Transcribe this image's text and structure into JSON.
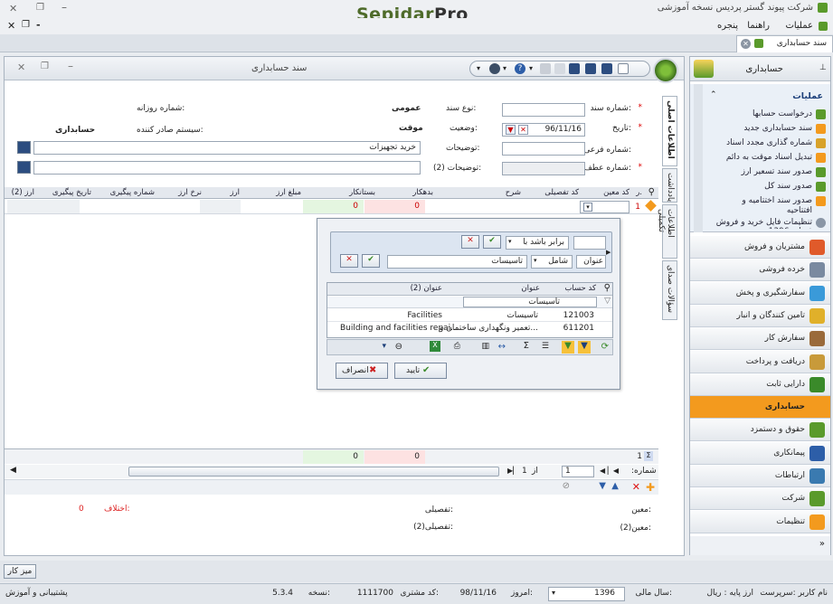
{
  "app": {
    "company_title": "شرکت پیوند گستر پردیس نسخه آموزشی",
    "logo_main": "Sepidar",
    "logo_pro": "Pro",
    "menu": [
      "عملیات",
      "راهنما",
      "پنجره"
    ]
  },
  "doc_tab": {
    "label": "سند حسابداری"
  },
  "window": {
    "title": "سند حسابداری"
  },
  "side_tabs": [
    "اطلاعات اصلی",
    "یادداشت",
    "اطلاعات تکمیلی",
    "سؤالات صدای"
  ],
  "form": {
    "doc_no_label": "شماره سند:",
    "doc_type_label": "نوع سند:",
    "doc_type_value": "عمومی",
    "daily_no_label": "شماره روزانه:",
    "date_label": "تاریخ:",
    "date_value": "96/11/16",
    "status_label": "وضعیت:",
    "status_value": "موقت",
    "issuer_label": "سیستم صادر کننده:",
    "issuer_value": "حسابداری",
    "sub_no_label": "شماره فرعی:",
    "desc_label": "توضیحات:",
    "desc_value": "خرید تجهیزات",
    "ref_no_label": "شماره عطف:",
    "desc2_label": "توضیحات (2):"
  },
  "grid": {
    "headers": [
      "ر.",
      "کد معین",
      "کد تفصیلی",
      "شرح",
      "بدهکار",
      "بستانکار",
      "مبلغ ارز",
      "ارز",
      "نرخ ارز",
      "شماره پیگیری",
      "تاریخ پیگیری",
      "ارز (2)"
    ],
    "row": {
      "index": "1",
      "debit": "0",
      "credit": "0"
    },
    "footer": {
      "count": "1",
      "debit": "0",
      "credit": "0"
    }
  },
  "pager": {
    "prefix": ":شماره",
    "current": "1",
    "of": "از",
    "total": "1"
  },
  "popup": {
    "filter1_value": "برابر باشد با",
    "filter2_label": "عنوان",
    "filter2_value": "شامل",
    "filter2_text": "تاسیسات",
    "cols": [
      "کد حساب",
      "عنوان",
      "عنوان (2)"
    ],
    "search_text": "تاسیسات",
    "rows": [
      {
        "code": "121003",
        "title": "تاسیسات",
        "title2": "Facilities"
      },
      {
        "code": "611201",
        "title": "تعمیر ونگهداری ساختمان و...",
        "title2": "Building and facilities repai..."
      }
    ],
    "ok_label": "تایید",
    "cancel_label": "انصراف"
  },
  "summary": {
    "moein_label": "معین:",
    "tafsili_label": "تفصیلی:",
    "moein2_label": "معین(2):",
    "tafsili2_label": "تفصیلی(2):",
    "diff_label": "اختلاف:",
    "diff_value": "0"
  },
  "right_panel": {
    "header": "حسابداری",
    "actions_title": "عملیات",
    "actions": [
      "درخواست حسابها",
      "سند حسابداری جدید",
      "شماره گذاری مجدد اسناد",
      "تبدیل اسناد موقت به دائم",
      "صدور سند تسعیر ارز",
      "صدور سند کل",
      "صدور سند اختتامیه و افتتاحیه",
      "تنظیمات فایل خرید و فروش فصلی 1396"
    ],
    "nav": [
      "مشتریان و فروش",
      "خرده فروشی",
      "سفارشگیری و پخش",
      "تامین کنندگان و انبار",
      "سفارش کار",
      "دریافت و پرداخت",
      "دارایی ثابت",
      "حسابداری",
      "حقوق و دستمزد",
      "پیمانکاری",
      "ارتباطات",
      "شرکت",
      "تنظیمات"
    ],
    "active_nav": "حسابداری"
  },
  "taskbar": {
    "label": "میز کار"
  },
  "status": {
    "user": "نام کاربر :سرپرست",
    "base_currency": "ارز پایه : ریال",
    "fiscal_label": "سال مالی:",
    "fiscal_value": "1396",
    "today_label": "امروز:",
    "today_value": "98/11/16",
    "customer_label": "کد مشتری:",
    "customer_value": "1111700",
    "version_label": "نسخه:",
    "version_value": "5.3.4",
    "support": "پشتیبانی و آموزش"
  },
  "colors": {
    "accent_orange": "#f39a1e",
    "debit_bg": "#fde2e2",
    "credit_bg": "#e4f6e0",
    "navy": "#1c3f7a"
  }
}
